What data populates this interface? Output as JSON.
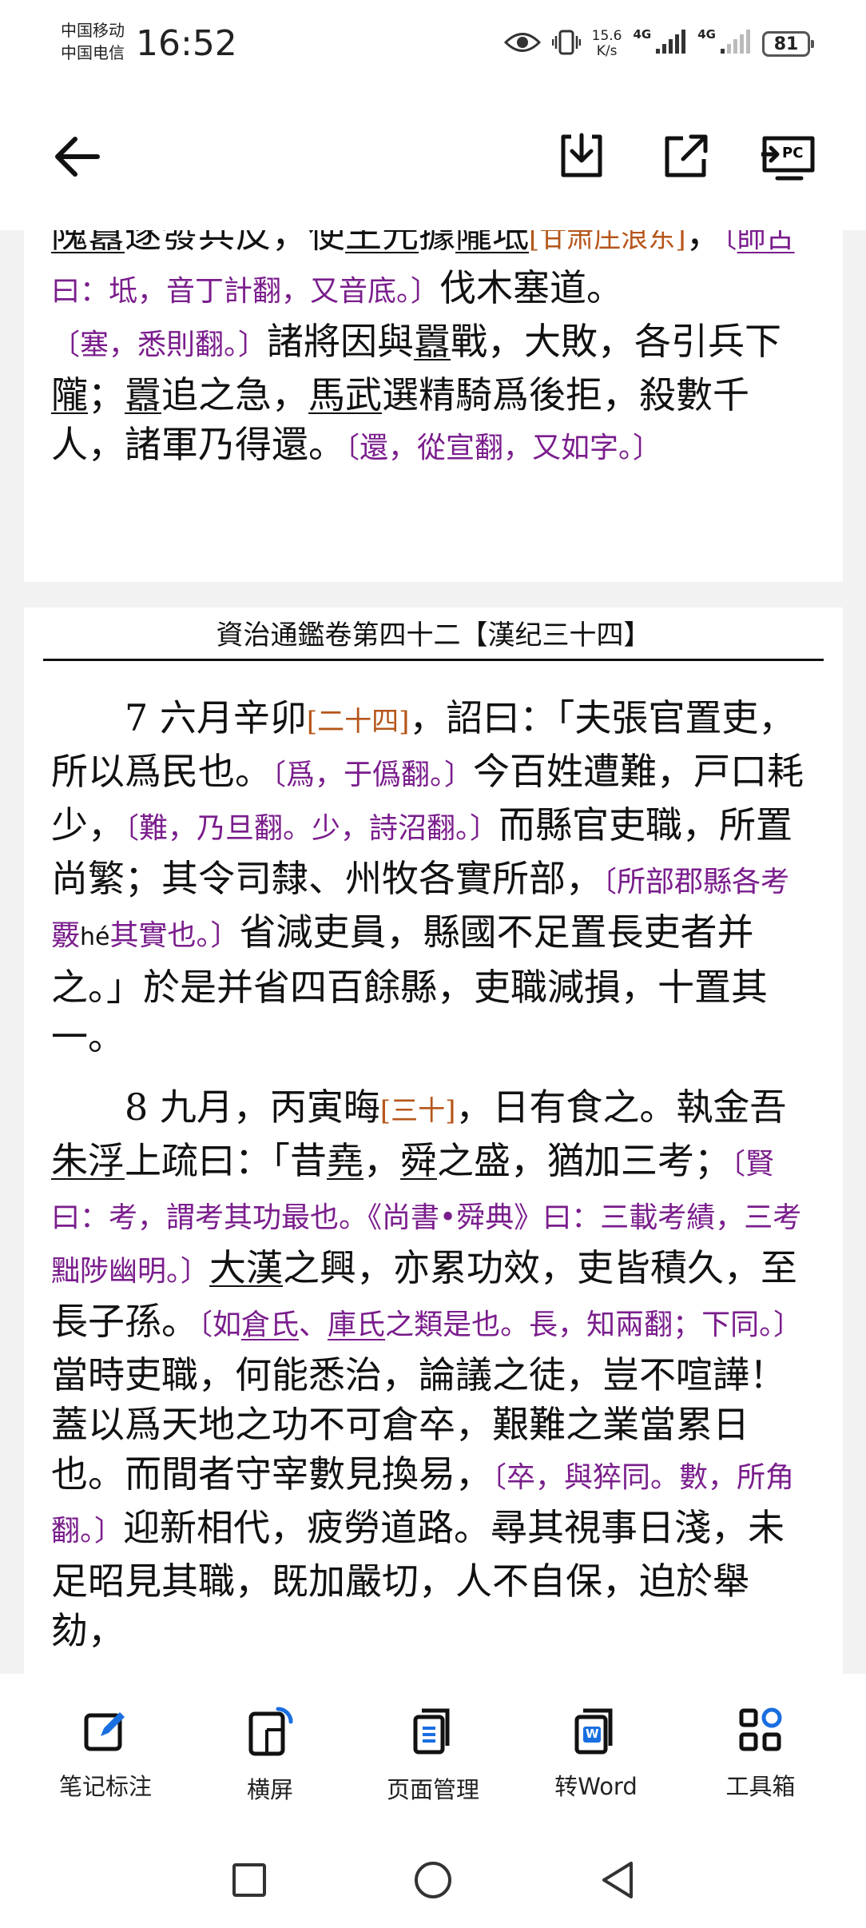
{
  "status_bar": {
    "carrier1": "中国移动",
    "carrier2": "中国电信",
    "time": "16:52",
    "net_speed_value": "15.6",
    "net_speed_unit": "K/s",
    "sig1_label": "4G",
    "sig2_label": "4G",
    "battery": "81"
  },
  "app_bar": {
    "back_icon": "arrow-left-icon",
    "download_icon": "download-icon",
    "share_icon": "share-icon",
    "pc_icon": "cast-to-pc-icon",
    "pc_label": "PC"
  },
  "page1": {
    "line1_a": "隗囂",
    "line1_b": "遂發兵反，使",
    "line1_c": "王元",
    "line1_d": "據",
    "line1_e": "隴坻",
    "line1_f": "[甘肃庄浪东]",
    "line1_g": "，",
    "line2_note_a": "〔",
    "line2_note_b": "師古",
    "line2_note_c": "曰：坻，音丁計翻，又音底。〕",
    "line2_d": "伐木塞道。",
    "line3_note": "〔塞，悉則翻。〕",
    "line3_b": "諸將因與",
    "line3_c": "囂",
    "line3_d": "戰，大敗，各引兵下",
    "line3_e": "隴",
    "line3_f": "；",
    "line3_g": "囂",
    "line3_h": "追之急，",
    "line3_i": "馬武",
    "line3_j": "選精騎爲後拒，殺數千人，諸軍乃得還。",
    "line3_note2": "〔還，從宣翻，又如字。〕"
  },
  "page2": {
    "running_head": "資治通鑑卷第四十二【漢纪三十四】",
    "p7_a": "7 六月辛卯",
    "p7_date": "[二十四]",
    "p7_b": "，詔曰：「夫張官置吏，所以爲民也。",
    "p7_note1": "〔爲，于僞翻。〕",
    "p7_c": "今百姓遭難，戸口耗少，",
    "p7_note2": "〔難，乃旦翻。少，詩沼翻。〕",
    "p7_d": "而縣官吏職，所置尚繁；其令司隸、州牧各實所部，",
    "p7_note3a": "〔所部郡縣各考覈",
    "p7_note3_pinyin": "hé",
    "p7_note3b": "其實也。〕",
    "p7_e": "省減吏員，縣國不足置長吏者并之。」於是并省四百餘縣，吏職減損，十置其一。",
    "p8_a": "8 九月，丙寅晦",
    "p8_date": "[三十]",
    "p8_b": "，日有食之。執金吾",
    "p8_c": "朱浮",
    "p8_d": "上疏曰：「昔",
    "p8_e": "堯",
    "p8_f": "，",
    "p8_g": "舜",
    "p8_h": "之盛，猶加三考；",
    "p8_note1": "〔賢曰：考，謂考其功最也。《尚書•舜典》曰：三載考績，三考黜陟幽明。〕",
    "p8_i": "大漢",
    "p8_j": "之興，亦累功效，吏皆積久，至長子孫。",
    "p8_note2a": "〔如",
    "p8_note2b": "倉氏",
    "p8_note2c": "、",
    "p8_note2d": "庫氏",
    "p8_note2e": "之類是也。長，知兩翻；下同。〕",
    "p8_k": "當時吏職，何能悉治，論議之徒，豈不喧譁！蓋以爲天地之功不可倉卒，艱難之業當累日也。而間者守宰數見換易，",
    "p8_note3": "〔卒，與猝同。數，所角翻。〕",
    "p8_l": "迎新相代，疲勞道路。尋其視事日淺，未足昭見其職，既加嚴切，人不自保，迫於舉劾，"
  },
  "toolbar": {
    "items": [
      {
        "label": "笔记标注",
        "icon": "note-edit-icon"
      },
      {
        "label": "横屏",
        "icon": "rotate-landscape-icon"
      },
      {
        "label": "页面管理",
        "icon": "page-manage-icon"
      },
      {
        "label": "转Word",
        "icon": "word-convert-icon"
      },
      {
        "label": "工具箱",
        "icon": "toolbox-icon"
      }
    ],
    "word_badge": "W"
  },
  "nav_bar": {
    "recent": "square-recent-icon",
    "home": "circle-home-icon",
    "back": "triangle-back-icon"
  },
  "colors": {
    "note_purple": "#7a1d8c",
    "date_orange": "#b5561a",
    "accent_blue": "#1a6fe0"
  }
}
